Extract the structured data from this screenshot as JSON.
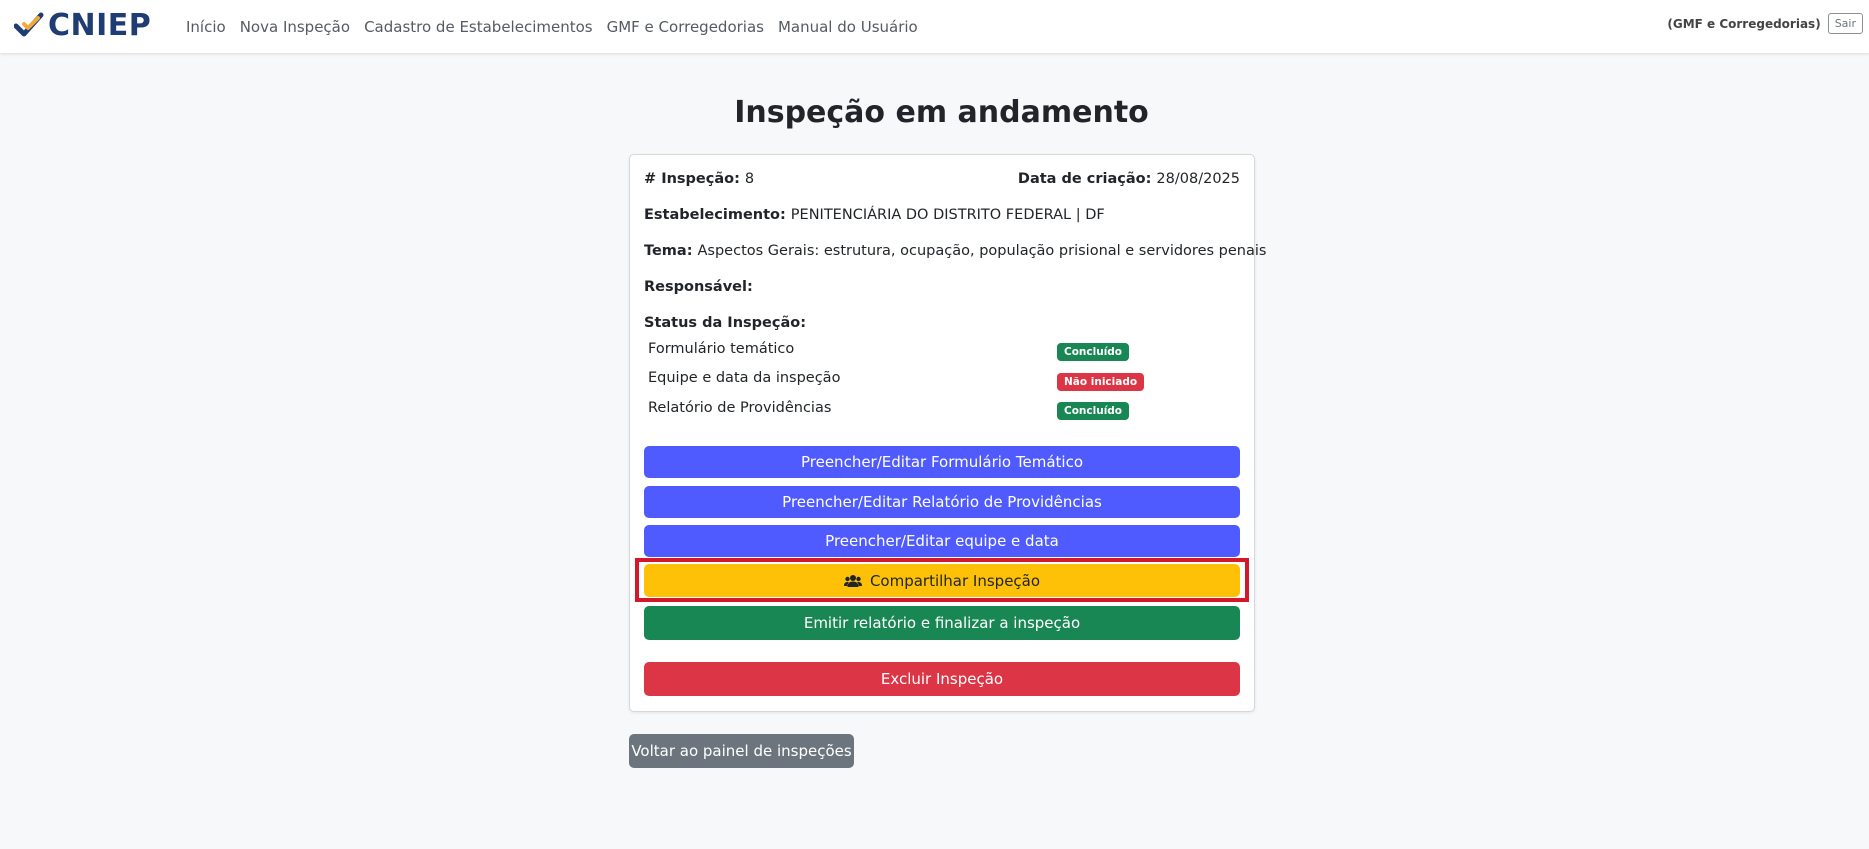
{
  "brand": {
    "name": "CNIEP"
  },
  "nav": {
    "links": [
      "Início",
      "Nova Inspeção",
      "Cadastro de Estabelecimentos",
      "GMF e Corregedorias",
      "Manual do Usuário"
    ],
    "user": "(GMF e Corregedorias)",
    "logout": "Sair"
  },
  "page": {
    "title": "Inspeção em andamento"
  },
  "inspection": {
    "number_label": "# Inspeção:",
    "number": "8",
    "date_label": "Data de criação:",
    "date": "28/08/2025",
    "establishment_label": "Estabelecimento:",
    "establishment": "PENITENCIÁRIA DO DISTRITO FEDERAL | DF",
    "theme_label": "Tema:",
    "theme": "Aspectos Gerais: estrutura, ocupação, população prisional e servidores penais",
    "responsible_label": "Responsável:",
    "status_label": "Status da Inspeção:",
    "status_items": [
      {
        "label": "Formulário temático",
        "status": "Concluído",
        "color": "#198754"
      },
      {
        "label": "Equipe e data da inspeção",
        "status": "Não iniciado",
        "color": "#dc3545"
      },
      {
        "label": "Relatório de Providências",
        "status": "Concluído",
        "color": "#198754"
      }
    ]
  },
  "actions": {
    "edit_form": "Preencher/Editar Formulário Temático",
    "edit_report": "Preencher/Editar Relatório de Providências",
    "edit_team": "Preencher/Editar equipe e data",
    "share": "Compartilhar Inspeção",
    "finalize": "Emitir relatório e finalizar a inspeção",
    "delete": "Excluir Inspeção",
    "back": "Voltar ao painel de inspeções"
  },
  "icons": {
    "brand": "check-logo-icon",
    "share": "users-icon"
  },
  "colors": {
    "primary": "#4f5bff",
    "warning": "#ffc107",
    "success": "#198754",
    "danger": "#dc3545",
    "secondary": "#6c757d",
    "highlight": "#d3182b",
    "brand": "#1f3d73"
  }
}
